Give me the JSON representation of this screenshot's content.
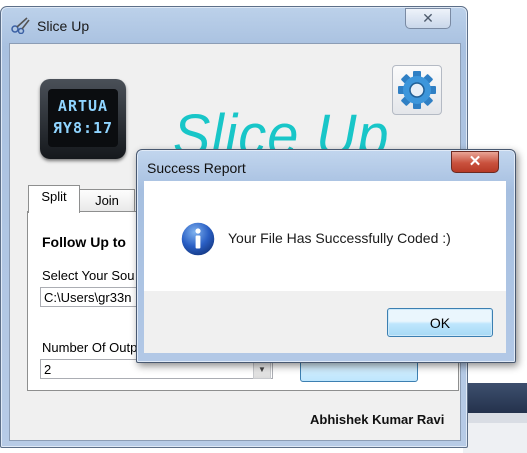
{
  "main_window": {
    "title": "Slice Up",
    "close_glyph": "✕",
    "logo": {
      "line1": "ARTUA",
      "line2": "ЯY8:17"
    },
    "brand": "Slice Up",
    "tabs": [
      {
        "label": "Split"
      },
      {
        "label": "Join"
      }
    ],
    "split_panel": {
      "heading": "Follow Up to",
      "source_label": "Select Your Sou",
      "source_value": "C:\\Users\\gr33n",
      "parts_label": "Number Of Outp",
      "parts_value": "2",
      "dropdown_arrow": "▼"
    },
    "author": "Abhishek Kumar Ravi",
    "icons": {
      "title_icon": "scissors-icon",
      "settings": "gear-icon"
    }
  },
  "dialog": {
    "title": "Success Report",
    "close_glyph": "✕",
    "message": "Your File Has Successfully Coded :)",
    "ok_label": "OK",
    "icon": "info-icon"
  },
  "colors": {
    "brand": "#18c6c8",
    "title_bar": "#b2c8e6",
    "dialog_close": "#c9513d",
    "button_accent": "#3c7fb1"
  }
}
